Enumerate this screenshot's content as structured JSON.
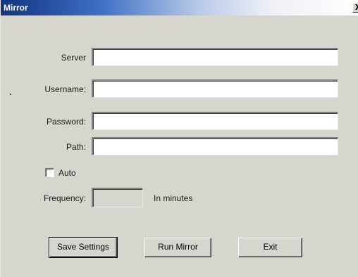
{
  "window": {
    "title": "Mirror",
    "close_glyph": "X"
  },
  "form": {
    "server_label": "Server",
    "server_value": "",
    "username_label": "Username:",
    "username_value": "",
    "password_label": "Password:",
    "password_value": "",
    "path_label": "Path:",
    "path_value": "",
    "auto_label": "Auto",
    "auto_checked": false,
    "frequency_label": "Frequency:",
    "frequency_value": "",
    "frequency_unit": "In minutes"
  },
  "buttons": {
    "save_label": "Save Settings",
    "run_label": "Run Mirror",
    "exit_label": "Exit"
  },
  "colors": {
    "titlebar_dark": "#11357f",
    "dialog_face": "#d7d6ce"
  }
}
